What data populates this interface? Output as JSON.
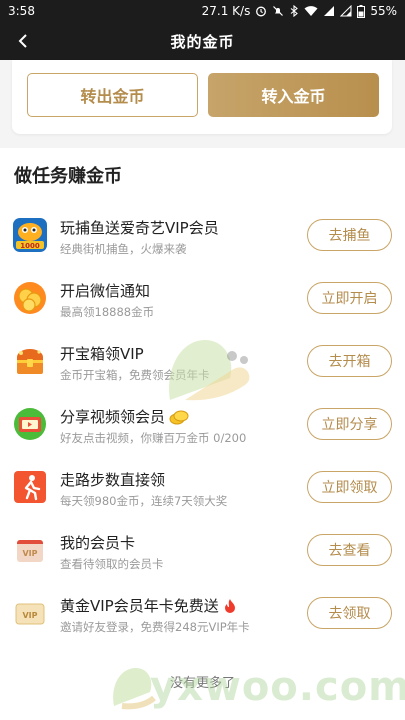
{
  "status": {
    "time": "3:58",
    "speed": "27.1 K/s",
    "battery": "55%"
  },
  "nav": {
    "title": "我的金币"
  },
  "transfer": {
    "out_label": "转出金币",
    "in_label": "转入金币"
  },
  "tasks_section": {
    "title": "做任务赚金币",
    "items": [
      {
        "title": "玩捕鱼送爱奇艺VIP会员",
        "subtitle": "经典街机捕鱼，火爆来袭",
        "button": "去捕鱼",
        "icon": "fishing-game-icon"
      },
      {
        "title": "开启微信通知",
        "subtitle": "最高领18888金币",
        "button": "立即开启",
        "icon": "coins-icon"
      },
      {
        "title": "开宝箱领VIP",
        "subtitle": "金币开宝箱，免费领会员年卡",
        "button": "去开箱",
        "icon": "treasure-chest-icon"
      },
      {
        "title": "分享视频领会员",
        "subtitle": "好友点击视频，你赚百万金币 0/200",
        "button": "立即分享",
        "icon": "share-video-icon"
      },
      {
        "title": "走路步数直接领",
        "subtitle": "每天领980金币，连续7天领大奖",
        "button": "立即领取",
        "icon": "walking-icon"
      },
      {
        "title": "我的会员卡",
        "subtitle": "查看待领取的会员卡",
        "button": "去查看",
        "icon": "vip-card-icon"
      },
      {
        "title": "黄金VIP会员年卡免费送",
        "subtitle": "邀请好友登录，免费得248元VIP年卡",
        "button": "去领取",
        "icon": "gold-vip-icon"
      }
    ],
    "footer": "没有更多了"
  },
  "watermark": {
    "text": "yxwoo.com"
  },
  "colors": {
    "accent_gold": "#b48c4c",
    "nav_bg": "#1c1c1c",
    "page_bg": "#f4f4f4"
  }
}
